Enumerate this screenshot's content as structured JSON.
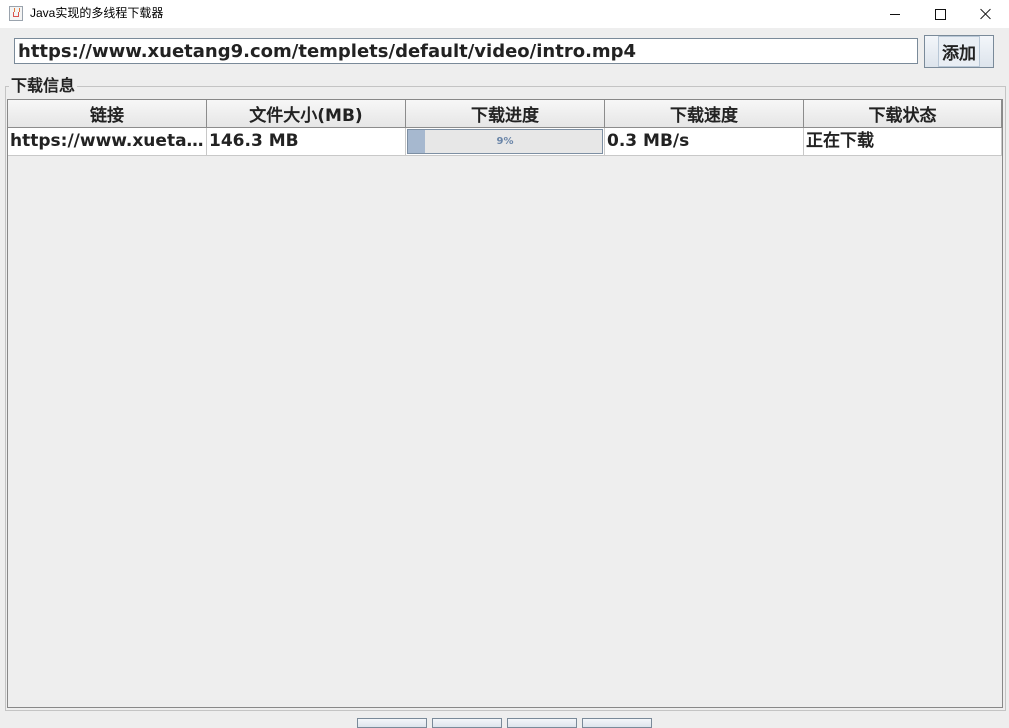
{
  "window": {
    "title": "Java实现的多线程下载器"
  },
  "toolbar": {
    "url_value": "https://www.xuetang9.com/templets/default/video/intro.mp4",
    "add_label": "添加"
  },
  "panel": {
    "title": "下载信息"
  },
  "table": {
    "headers": [
      "链接",
      "文件大小(MB)",
      "下载进度",
      "下载速度",
      "下载状态"
    ],
    "rows": [
      {
        "link": "https://www.xuetang9.com/templets/default/video/intro.mp4",
        "size": "146.3 MB",
        "progress": 9,
        "progress_label": "9%",
        "speed": "0.3 MB/s",
        "status": "正在下载"
      }
    ]
  },
  "bottom_buttons_count": 4,
  "colors": {
    "progress_fill": "#a6b8cf",
    "progress_text": "#6a85a8"
  }
}
